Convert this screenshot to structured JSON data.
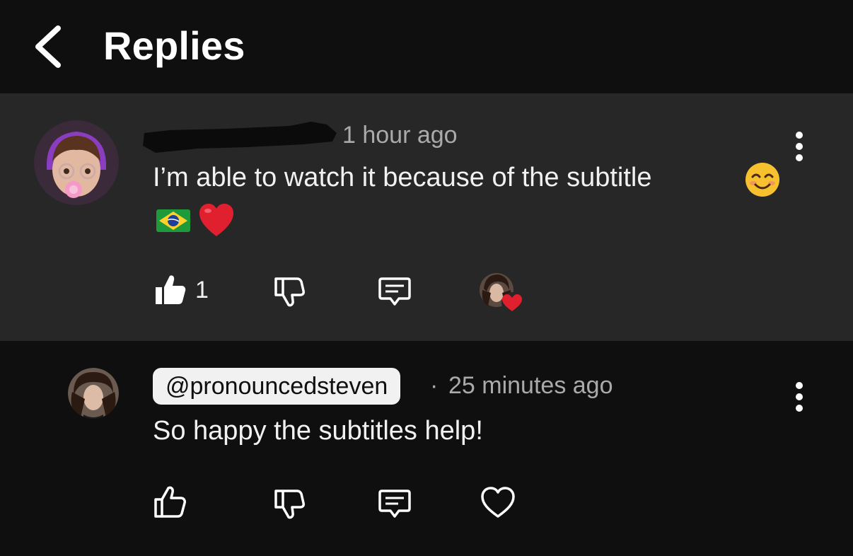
{
  "header": {
    "title": "Replies"
  },
  "comment": {
    "timestamp": "1 hour ago",
    "text": "I’m able to watch it because of the subtitle",
    "emojis": [
      "smiling-face-emoji",
      "brazil-flag-emoji",
      "red-heart-emoji"
    ],
    "like_count": "1",
    "hearted_by_creator": true
  },
  "reply": {
    "handle": "@pronouncedsteven",
    "separator": "·",
    "timestamp": "25 minutes ago",
    "text": "So happy the subtitles help!"
  },
  "colors": {
    "background": "#0f0f0f",
    "highlighted_comment_bg": "#272727",
    "text_primary": "#f1f1f1",
    "text_secondary": "#aaaaaa",
    "heart_red": "#e0202e"
  }
}
